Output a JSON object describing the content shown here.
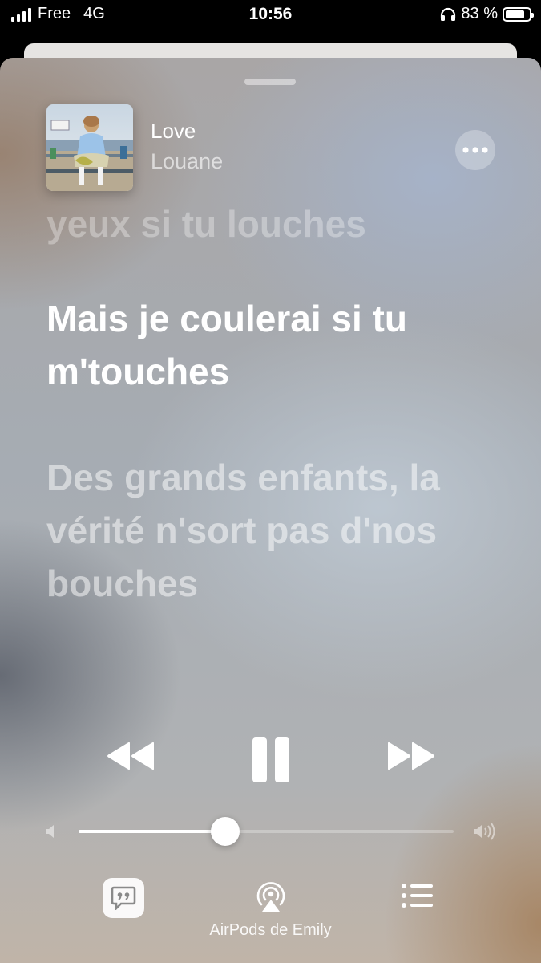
{
  "status_bar": {
    "carrier": "Free",
    "network": "4G",
    "time": "10:56",
    "battery_text": "83 %",
    "battery_level": 0.83
  },
  "now_playing": {
    "title": "Love",
    "artist": "Louane",
    "artwork_icon": "album-artwork"
  },
  "lyrics": {
    "previous": "yeux si tu louches",
    "current": "Mais je coulerai si tu m'touches",
    "next": "Des grands enfants, la vérité n'sort pas d'nos bouches"
  },
  "playback": {
    "previous_icon": "rewind-icon",
    "pause_icon": "pause-icon",
    "next_icon": "fast-forward-icon",
    "volume_level": 0.39
  },
  "bottom_bar": {
    "lyrics_icon": "lyrics-quote-icon",
    "airplay_icon": "airplay-audio-icon",
    "airplay_device": "AirPods de Emily",
    "queue_icon": "queue-list-icon"
  },
  "colors": {
    "text_primary": "#ffffff",
    "background_top": "#a9a6a6",
    "background_bottom": "#c0b4a8"
  }
}
